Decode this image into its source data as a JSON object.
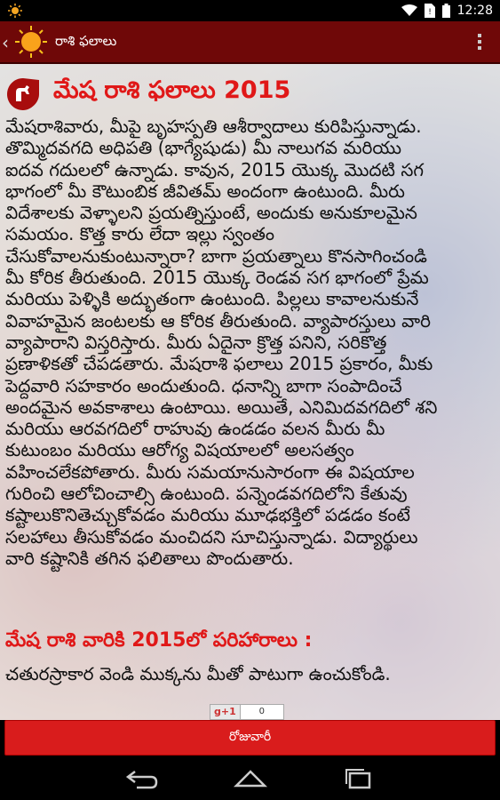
{
  "status_bar": {
    "time": "12:28"
  },
  "action_bar": {
    "title": "రాశి ఫలాలు"
  },
  "article": {
    "heading": "మేష రాశి ఫలాలు 2015",
    "paragraph_lines": [
      "మేషరాశివారు, మీపై బృహస్పతి ఆశీర్వాదాలు కురిపిస్తున్నాడు.",
      "తొమ్మిదవగది అధిపతి (భాగ్యేషుడు) మీ నాలుగవ మరియు",
      "ఐదవ గదులలో ఉన్నాడు. కావున, 2015 యొక్క మొదటి సగ",
      "భాగంలో మీ కౌటుంబిక జీవితమ్ అందంగా ఉంటుంది. మీరు",
      "విదేశాలకు వెళ్ళాలని ప్రయత్నిస్తుంటే, అందుకు అనుకూలమైన",
      "సమయం. కొత్త కారు లేదా ఇల్లు స్వంతం",
      "చేసుకోవాలనుకుంటున్నారా? బాగా ప్రయత్నాలు కొనసాగించండి",
      "మీ కోరిక తీరుతుంది. 2015 యొక్క రెండవ సగ భాగంలో ప్రేమ",
      "మరియు పెళ్ళికి అద్భుతంగా ఉంటుంది. పిల్లలు కావాలనుకునే",
      "వివాహమైన జంటలకు ఆ కోరిక తీరుతుంది. వ్యాపారస్తులు వారి",
      "వ్యాపారాని విస్తరిస్తారు. మీరు ఏదైనా క్రొత్త పనిని, సరికొత్త",
      "ప్రణాళికతో చేపడతారు. మేషరాశి ఫలాలు 2015 ప్రకారం, మీకు",
      "పెద్దవారి సహకారం అందుతుంది. ధనాన్ని బాగా సంపాదించే",
      "అందమైన అవకాశాలు ఉంటాయి. అయితే, ఎనిమిదవగదిలో శని",
      "మరియు ఆరవగదిలో రాహువు ఉండడం వలన మీరు మీ",
      "కుటుంబం మరియు ఆరోగ్య విషయాలలో అలసత్వం",
      "వహించలేకపోతారు. మీరు సమయానుసారంగా ఈ విషయాల",
      "గురించి ఆలోచించాల్సి ఉంటుంది. పన్నెండవగదిలోని కేతువు",
      "కష్టాలుకొనితెచ్చుకోవడం మరియు మూఢభక్తిలో పడడం కంటే",
      "సలహాలు తీసుకోవడం మంచిదని సూచిస్తున్నాడు. విద్యార్థులు",
      "వారి కష్టానికి తగిన ఫలితాలు పొందుతారు."
    ],
    "remedy_heading": "మేష రాశి వారికి 2015లో పరిహారాలు :",
    "remedy_text": "చతురస్రాకార వెండి ముక్కను మీతో పాటుగా ఉంచుకోండి."
  },
  "plus_one": {
    "label": "g+1",
    "count": "0"
  },
  "daily_button": {
    "label": "రోజువారీ"
  },
  "colors": {
    "action_bar": "#6f0808",
    "heading": "#e01818",
    "button": "#d91c1c"
  }
}
